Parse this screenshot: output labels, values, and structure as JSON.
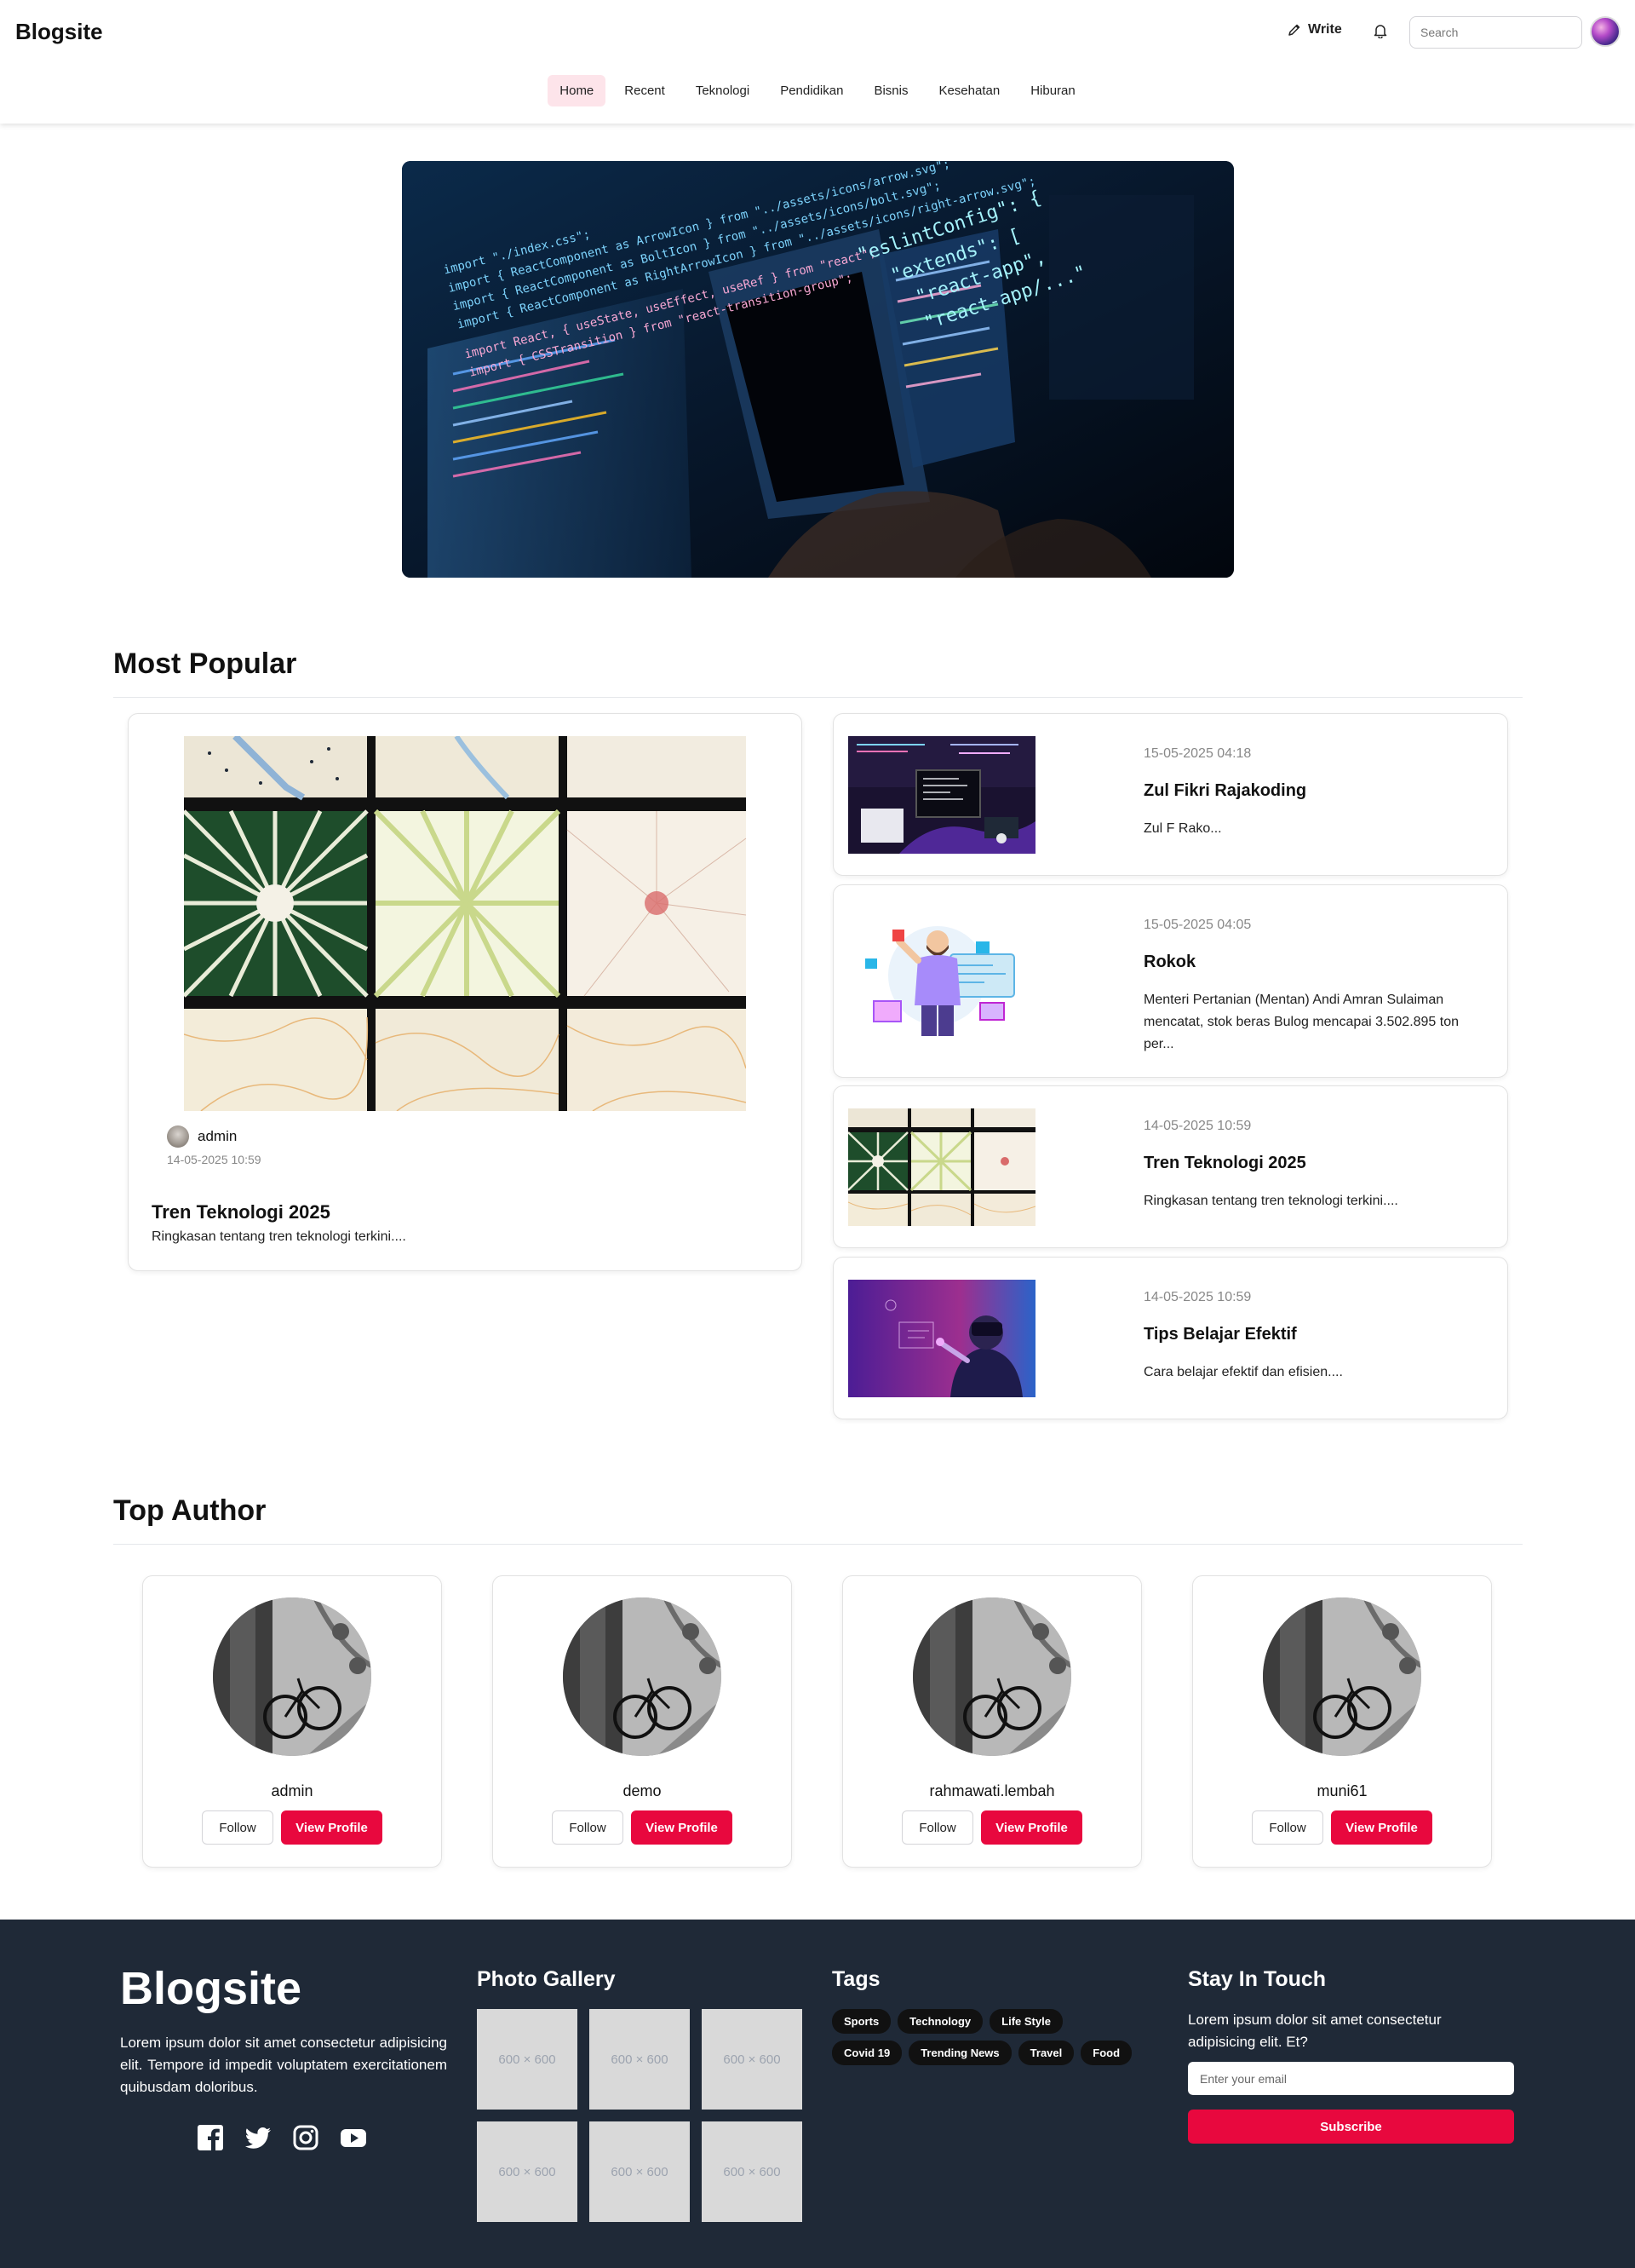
{
  "header": {
    "logo": "Blogsite",
    "write_label": "Write",
    "search_placeholder": "Search",
    "nav": [
      "Home",
      "Recent",
      "Teknologi",
      "Pendidikan",
      "Bisnis",
      "Kesehatan",
      "Hiburan"
    ],
    "active_nav": "Home"
  },
  "most_popular": {
    "title": "Most Popular",
    "featured": {
      "author": "admin",
      "date": "14-05-2025 10:59",
      "title": "Tren Teknologi 2025",
      "excerpt": "Ringkasan tentang tren teknologi terkini...."
    },
    "posts": [
      {
        "date": "15-05-2025 04:18",
        "title": "Zul Fikri Rajakoding",
        "excerpt": "Zul F Rako..."
      },
      {
        "date": "15-05-2025 04:05",
        "title": "Rokok",
        "excerpt": "Menteri Pertanian (Mentan) Andi Amran Sulaiman mencatat, stok beras Bulog mencapai 3.502.895 ton per..."
      },
      {
        "date": "14-05-2025 10:59",
        "title": "Tren Teknologi 2025",
        "excerpt": "Ringkasan tentang tren teknologi terkini...."
      },
      {
        "date": "14-05-2025 10:59",
        "title": "Tips Belajar Efektif",
        "excerpt": "Cara belajar efektif dan efisien...."
      }
    ]
  },
  "top_author": {
    "title": "Top Author",
    "follow_label": "Follow",
    "view_label": "View Profile",
    "authors": [
      "admin",
      "demo",
      "rahmawati.lembah",
      "muni61"
    ]
  },
  "footer": {
    "logo": "Blogsite",
    "about": "Lorem ipsum dolor sit amet consectetur adipisicing elit. Tempore id impedit voluptatem exercitationem quibusdam doloribus.",
    "gallery_title": "Photo Gallery",
    "gallery_placeholder": "600 × 600",
    "tags_title": "Tags",
    "tags": [
      "Sports",
      "Technology",
      "Life Style",
      "Covid 19",
      "Trending News",
      "Travel",
      "Food"
    ],
    "touch_title": "Stay In Touch",
    "touch_text": "Lorem ipsum dolor sit amet consectetur adipisicing elit. Et?",
    "email_placeholder": "Enter your email",
    "subscribe_label": "Subscribe",
    "social": [
      "facebook-icon",
      "twitter-icon",
      "instagram-icon",
      "youtube-icon"
    ]
  },
  "colors": {
    "accent": "#e8083e",
    "nav_active_bg": "#fde4ea",
    "footer_bg": "#1f2937",
    "tag_bg": "#111111"
  }
}
